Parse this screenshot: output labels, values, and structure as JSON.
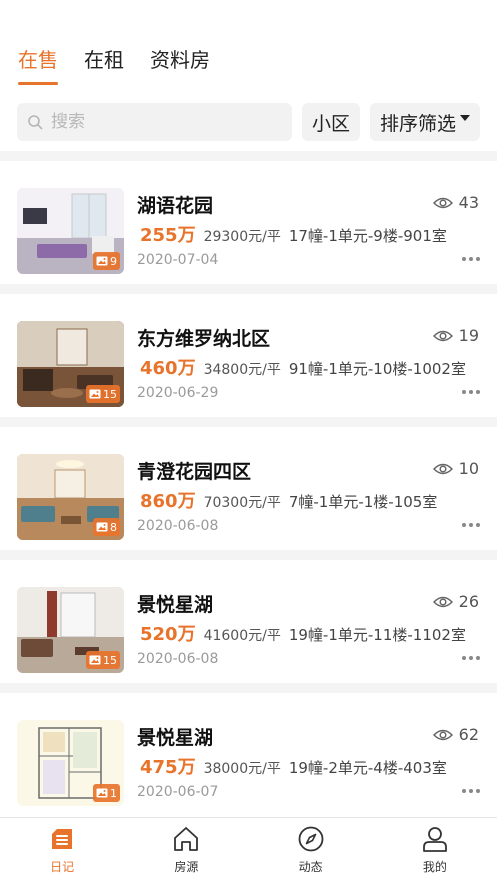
{
  "tabs": [
    {
      "label": "在售",
      "active": true
    },
    {
      "label": "在租",
      "active": false
    },
    {
      "label": "资料房",
      "active": false
    }
  ],
  "search": {
    "placeholder": "搜索",
    "icon": "search-icon"
  },
  "filters": {
    "community_label": "小区",
    "sort_label": "排序筛选"
  },
  "accent_color": "#e8732b",
  "listings": [
    {
      "title": "湖语花园",
      "views": "43",
      "price": "255万",
      "unit_price": "29300元/平",
      "room": "17幢-1单元-9楼-901室",
      "date": "2020-07-04",
      "photos": "9",
      "thumb": "living-room-purple"
    },
    {
      "title": "东方维罗纳北区",
      "views": "19",
      "price": "460万",
      "unit_price": "34800元/平",
      "room": "91幢-1单元-10楼-1002室",
      "date": "2020-06-29",
      "photos": "15",
      "thumb": "living-room-wood"
    },
    {
      "title": "青澄花园四区",
      "views": "10",
      "price": "860万",
      "unit_price": "70300元/平",
      "room": "7幢-1单元-1楼-105室",
      "date": "2020-06-08",
      "photos": "8",
      "thumb": "living-room-bright"
    },
    {
      "title": "景悦星湖",
      "views": "26",
      "price": "520万",
      "unit_price": "41600元/平",
      "room": "19幢-1单元-11楼-1102室",
      "date": "2020-06-08",
      "photos": "15",
      "thumb": "living-room-white"
    },
    {
      "title": "景悦星湖",
      "views": "62",
      "price": "475万",
      "unit_price": "38000元/平",
      "room": "19幢-2单元-4楼-403室",
      "date": "2020-06-07",
      "photos": "1",
      "thumb": "floor-plan"
    }
  ],
  "bottom_nav": [
    {
      "label": "日记",
      "icon": "diary-icon",
      "active": true
    },
    {
      "label": "房源",
      "icon": "house-icon",
      "active": false
    },
    {
      "label": "动态",
      "icon": "compass-icon",
      "active": false
    },
    {
      "label": "我的",
      "icon": "profile-icon",
      "active": false
    }
  ]
}
